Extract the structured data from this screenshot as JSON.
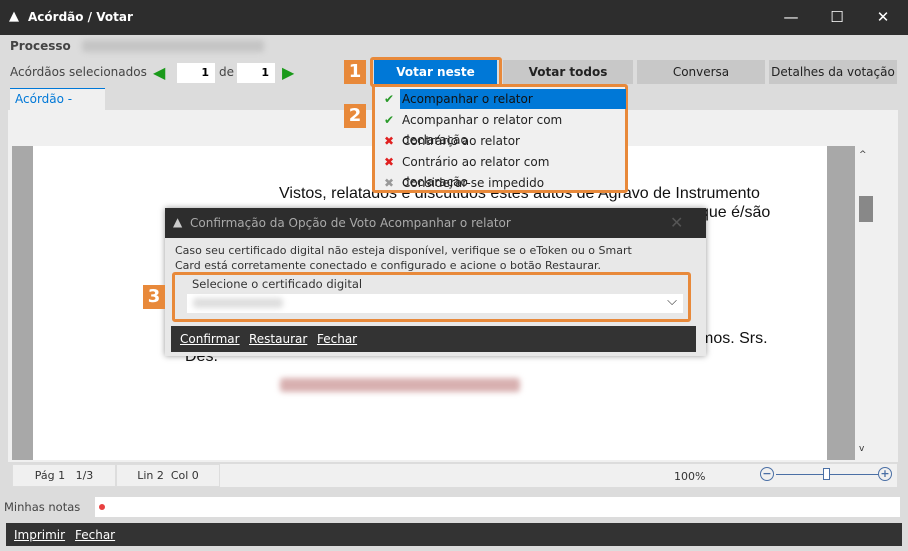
{
  "window": {
    "title": "Acórdão / Votar",
    "minimize": "—",
    "maximize": "☐",
    "close": "✕"
  },
  "header": {
    "processo_label": "Processo",
    "selected_label": "Acórdãos selecionados",
    "current": "1",
    "of_label": "de",
    "total": "1"
  },
  "tabs": [
    {
      "label": "Votar neste",
      "active": true
    },
    {
      "label": "Votar todos"
    },
    {
      "label": "Conversa"
    },
    {
      "label": "Detalhes da votação"
    }
  ],
  "doc_tab": "Acórdão - DRPW",
  "badges": [
    "1",
    "2",
    "3"
  ],
  "vote_menu": [
    {
      "label": "Acompanhar o relator",
      "icon": "check-icon",
      "selected": true
    },
    {
      "label": "Acompanhar o relator com declaração",
      "icon": "document-check-icon"
    },
    {
      "label": "Contrário ao relator",
      "icon": "x-icon"
    },
    {
      "label": "Contrário ao relator com declaração",
      "icon": "document-x-icon"
    },
    {
      "label": "Considerar-se impedido",
      "icon": "gray-x-icon"
    }
  ],
  "document": {
    "line1": "Vistos, relatados e discutidos estes autos de Agravo de Instrumento",
    "line2_end": "que é/são",
    "line3_end": "mos. Srs.",
    "line4": "Des."
  },
  "dialog": {
    "title": "Confirmação da Opção de Voto Acompanhar o relator",
    "message": "Caso seu certificado digital não esteja disponível, verifique se o eToken ou o Smart Card está corretamente conectado e configurado e acione o botão Restaurar.",
    "group_label": "Selecione o certificado digital",
    "confirm": "Confirmar",
    "restore": "Restaurar",
    "close": "Fechar"
  },
  "status": {
    "page": "Pág 1",
    "pages": "1/3",
    "line": "Lin 2",
    "col": "Col 0",
    "zoom": "100%",
    "zoom_level": 0.5
  },
  "notes": {
    "label": "Minhas notas"
  },
  "footer": {
    "print": "Imprimir",
    "close": "Fechar"
  },
  "colors": {
    "accent": "#0078d7",
    "highlight": "#e8893a",
    "dark": "#2d2d2d"
  }
}
